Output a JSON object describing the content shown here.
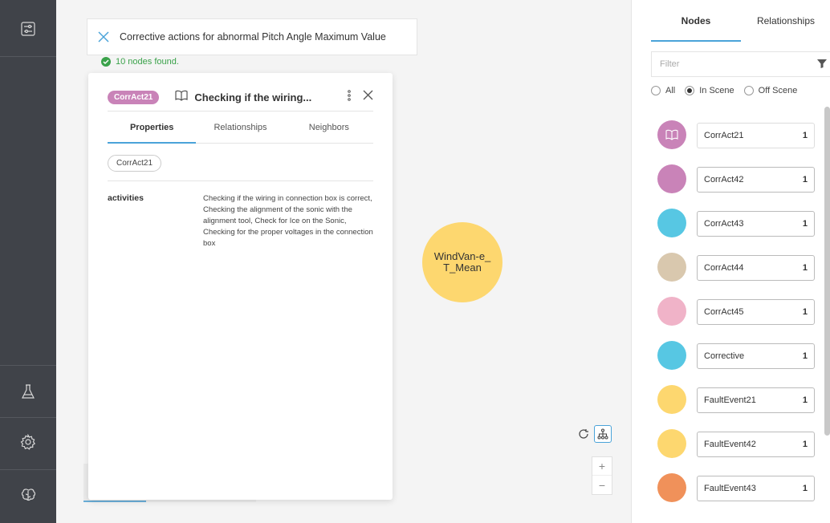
{
  "search": {
    "query": "Corrective actions for abnormal Pitch Angle Maximum Value",
    "results_text": "10 nodes found."
  },
  "detail_panel": {
    "chip": "CorrAct21",
    "title": "Checking if the wiring...",
    "tabs": [
      {
        "label": "Properties",
        "active": true
      },
      {
        "label": "Relationships",
        "active": false
      },
      {
        "label": "Neighbors",
        "active": false
      }
    ],
    "label_pill": "CorrAct21",
    "property": {
      "key": "activities",
      "value": "Checking if the wiring in connection box is correct, Checking the alignment of the sonic with the alignment tool, Check for Ice on the Sonic, Checking for the proper voltages in the connection box"
    }
  },
  "graph_node": {
    "label": "WindVan-e_T_Mean",
    "color": "#fdd76f"
  },
  "zoom": {
    "plus": "+",
    "minus": "−"
  },
  "right_panel": {
    "tabs": [
      {
        "label": "Nodes",
        "active": true
      },
      {
        "label": "Relationships",
        "active": false
      }
    ],
    "filter_placeholder": "Filter",
    "radios": [
      {
        "label": "All",
        "checked": false
      },
      {
        "label": "In Scene",
        "checked": true
      },
      {
        "label": "Off Scene",
        "checked": false
      }
    ],
    "nodes": [
      {
        "name": "CorrAct21",
        "count": "1",
        "color": "#c983b8",
        "icon": "book-icon"
      },
      {
        "name": "CorrAct42",
        "count": "1",
        "color": "#c983b8"
      },
      {
        "name": "CorrAct43",
        "count": "1",
        "color": "#57c7e3"
      },
      {
        "name": "CorrAct44",
        "count": "1",
        "color": "#d9c8ae"
      },
      {
        "name": "CorrAct45",
        "count": "1",
        "color": "#f0b3c8"
      },
      {
        "name": "Corrective",
        "count": "1",
        "color": "#57c7e3"
      },
      {
        "name": "FaultEvent21",
        "count": "1",
        "color": "#fdd76f"
      },
      {
        "name": "FaultEvent42",
        "count": "1",
        "color": "#fdd76f"
      },
      {
        "name": "FaultEvent43",
        "count": "1",
        "color": "#f0915a"
      }
    ]
  },
  "colors": {
    "sidebar": "#404349",
    "accent": "#4aa3d9",
    "success": "#3aa24a"
  }
}
